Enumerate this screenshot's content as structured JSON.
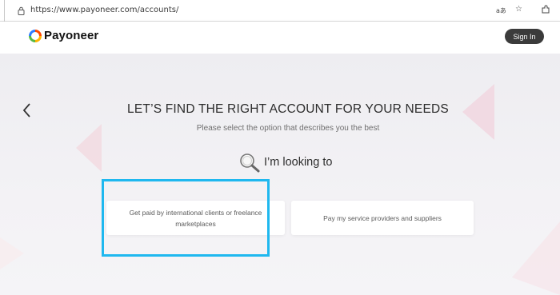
{
  "browser": {
    "url": "https://www.payoneer.com/accounts/",
    "icons": [
      "lock-icon",
      "read-aloud-icon",
      "favorites-icon",
      "extensions-icon"
    ]
  },
  "header": {
    "logo_text": "Payoneer",
    "signin_label": "Sign In"
  },
  "main": {
    "title": "LET’S FIND THE RIGHT ACCOUNT FOR YOUR NEEDS",
    "subtitle": "Please select the option that describes you the best",
    "looking_label": "I’m looking to",
    "options": [
      {
        "label": "Get paid by international clients or freelance marketplaces",
        "highlighted": true
      },
      {
        "label": "Pay my service providers and suppliers",
        "highlighted": false
      }
    ]
  },
  "colors": {
    "highlight": "#1fb8ef",
    "signin_bg": "#3b3b3b",
    "background": "#eeedf1"
  }
}
